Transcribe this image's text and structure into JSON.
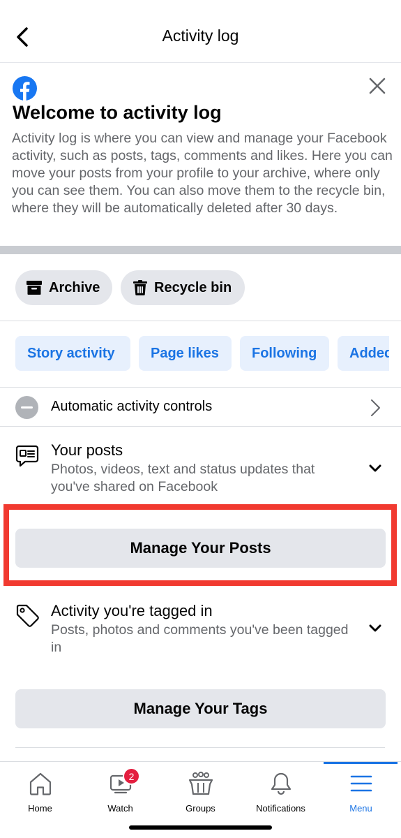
{
  "header": {
    "title": "Activity log"
  },
  "welcome": {
    "title": "Welcome to activity log",
    "body": "Activity log is where you can view and manage your Facebook activity, such as posts, tags, comments and likes. Here you can move your posts from your profile to your archive, where only you can see them. You can also move them to the recycle bin, where they will be automatically deleted after 30 days."
  },
  "storage_buttons": [
    {
      "label": "Archive",
      "icon": "archive-box-icon"
    },
    {
      "label": "Recycle bin",
      "icon": "trash-icon"
    }
  ],
  "filter_tabs": [
    "Story activity",
    "Page likes",
    "Following",
    "Added"
  ],
  "automatic_controls": {
    "label": "Automatic activity controls"
  },
  "sections": [
    {
      "title": "Your posts",
      "subtitle": "Photos, videos, text and status updates that you've shared on Facebook",
      "button": "Manage Your Posts",
      "icon": "posts-speech-bubble-icon"
    },
    {
      "title": "Activity you're tagged in",
      "subtitle": "Posts, photos and comments you've been tagged in",
      "button": "Manage Your Tags",
      "icon": "tag-icon"
    }
  ],
  "bottom_nav": [
    {
      "label": "Home",
      "icon": "home-icon"
    },
    {
      "label": "Watch",
      "icon": "watch-video-icon",
      "badge": "2"
    },
    {
      "label": "Groups",
      "icon": "groups-icon"
    },
    {
      "label": "Notifications",
      "icon": "bell-icon"
    },
    {
      "label": "Menu",
      "icon": "hamburger-menu-icon",
      "active": true
    }
  ],
  "colors": {
    "accent": "#1b74e4",
    "highlight": "#f13a30",
    "badge": "#e41e3f",
    "button_bg": "#e4e6eb",
    "tab_bg": "#e7f0fd"
  }
}
